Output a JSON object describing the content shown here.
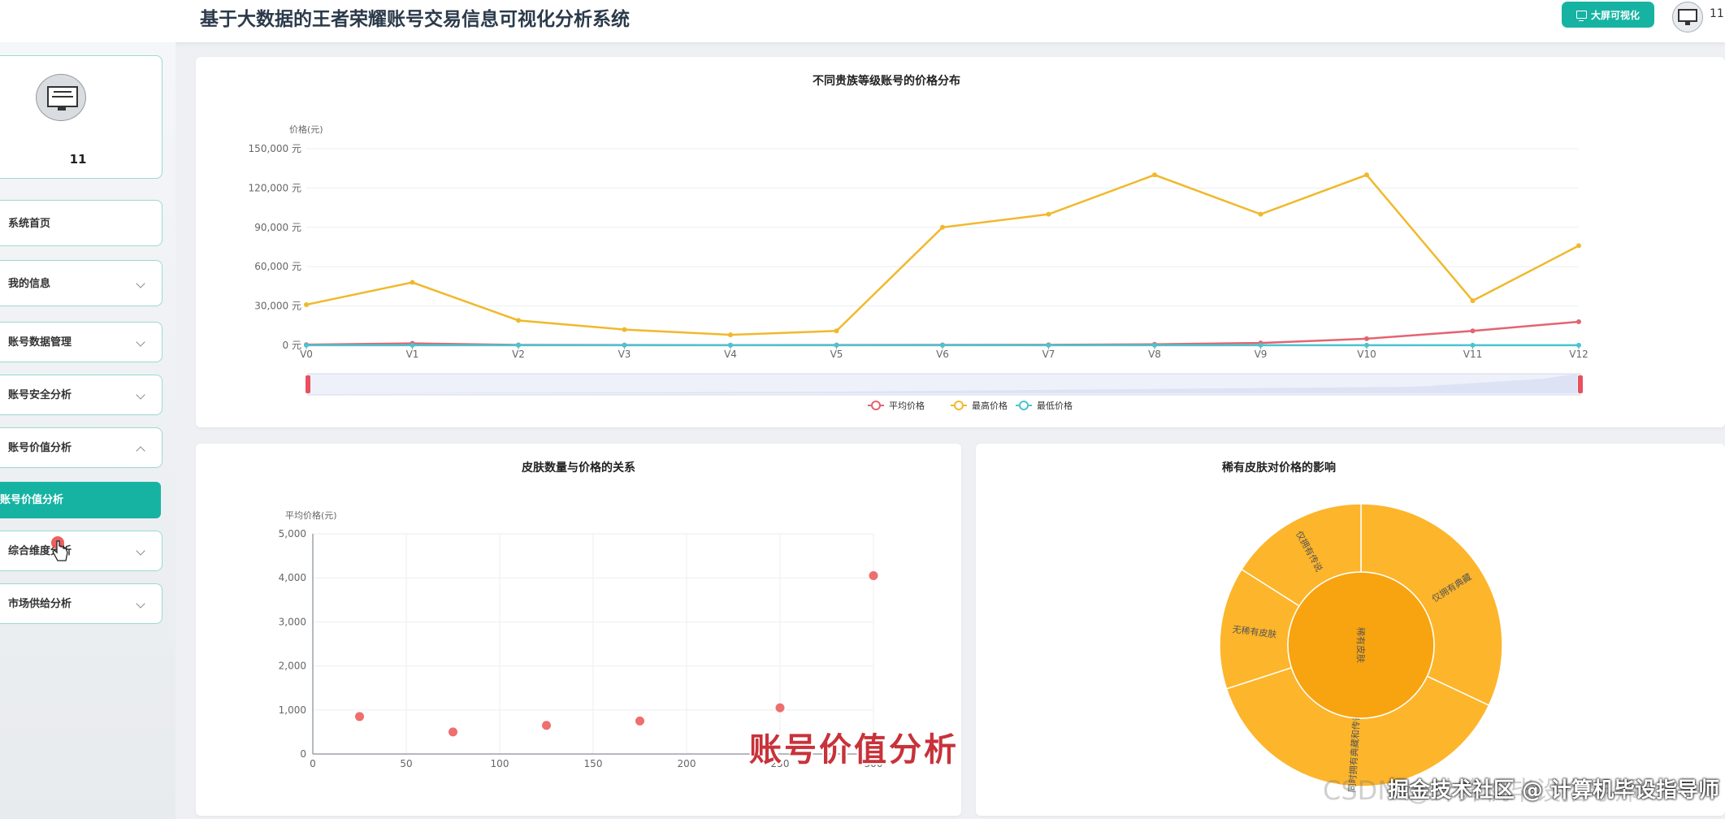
{
  "header": {
    "title": "基于大数据的王者荣耀账号交易信息可视化分析系统",
    "bigscreen_label": "大屏可视化",
    "username": "11"
  },
  "sidebar": {
    "username": "11",
    "items": [
      {
        "label": "系统首页",
        "chevron": "none"
      },
      {
        "label": "我的信息",
        "chevron": "down"
      },
      {
        "label": "账号数据管理",
        "chevron": "down"
      },
      {
        "label": "账号安全分析",
        "chevron": "down"
      },
      {
        "label": "账号价值分析",
        "chevron": "up"
      },
      {
        "label": "综合维度分析",
        "chevron": "down"
      },
      {
        "label": "市场供给分析",
        "chevron": "down"
      }
    ],
    "active_sub": "账号价值分析"
  },
  "colors": {
    "accent": "#16b3a3",
    "avg": "#e36471",
    "max": "#f0b92d",
    "min": "#4bc4cf",
    "scatter": "#ee6666",
    "sunburst_outer": "#fdb52b",
    "sunburst_inner": "#f8a410"
  },
  "chart_data": [
    {
      "type": "line",
      "title": "不同贵族等级账号的价格分布",
      "ylabel": "价格(元)",
      "y_unit": "元",
      "categories": [
        "V0",
        "V1",
        "V2",
        "V3",
        "V4",
        "V5",
        "V6",
        "V7",
        "V8",
        "V9",
        "V10",
        "V11",
        "V12"
      ],
      "ylim": [
        0,
        150000
      ],
      "yticks": [
        0,
        30000,
        60000,
        90000,
        120000,
        150000
      ],
      "series": [
        {
          "name": "平均价格",
          "values": [
            500,
            1500,
            300,
            200,
            150,
            200,
            300,
            400,
            800,
            1800,
            5000,
            11000,
            18000
          ]
        },
        {
          "name": "最高价格",
          "values": [
            31000,
            48000,
            19000,
            12000,
            8000,
            11000,
            90000,
            100000,
            130000,
            100000,
            130000,
            34000,
            76000
          ]
        },
        {
          "name": "最低价格",
          "values": [
            50,
            50,
            50,
            50,
            50,
            50,
            50,
            50,
            50,
            50,
            50,
            50,
            50
          ]
        }
      ],
      "legend": "bottom-center",
      "grid": true
    },
    {
      "type": "scatter",
      "title": "皮肤数量与价格的关系",
      "ylabel": "平均价格(元)",
      "xlim": [
        0,
        300
      ],
      "ylim": [
        0,
        5000
      ],
      "xticks": [
        0,
        50,
        100,
        150,
        200,
        250,
        300
      ],
      "yticks": [
        0,
        1000,
        2000,
        3000,
        4000,
        5000
      ],
      "points": [
        {
          "x": 25,
          "y": 850
        },
        {
          "x": 75,
          "y": 500
        },
        {
          "x": 125,
          "y": 650
        },
        {
          "x": 175,
          "y": 750
        },
        {
          "x": 250,
          "y": 1050
        },
        {
          "x": 300,
          "y": 4050
        }
      ],
      "grid": true
    },
    {
      "type": "sunburst",
      "title": "稀有皮肤对价格的影响",
      "inner": {
        "name": "稀有皮肤"
      },
      "outer": [
        {
          "name": "仅拥有典藏",
          "value": 32
        },
        {
          "name": "同时拥有典藏和传说",
          "value": 38
        },
        {
          "name": "无稀有皮肤",
          "value": 14
        },
        {
          "name": "仅拥有传说",
          "value": 16
        }
      ]
    }
  ],
  "watermarks": {
    "title": "账号价值分析",
    "csdn": "CSDN @计算机毕设指导师",
    "juejin": "掘金技术社区 @ 计算机毕设指导师"
  }
}
